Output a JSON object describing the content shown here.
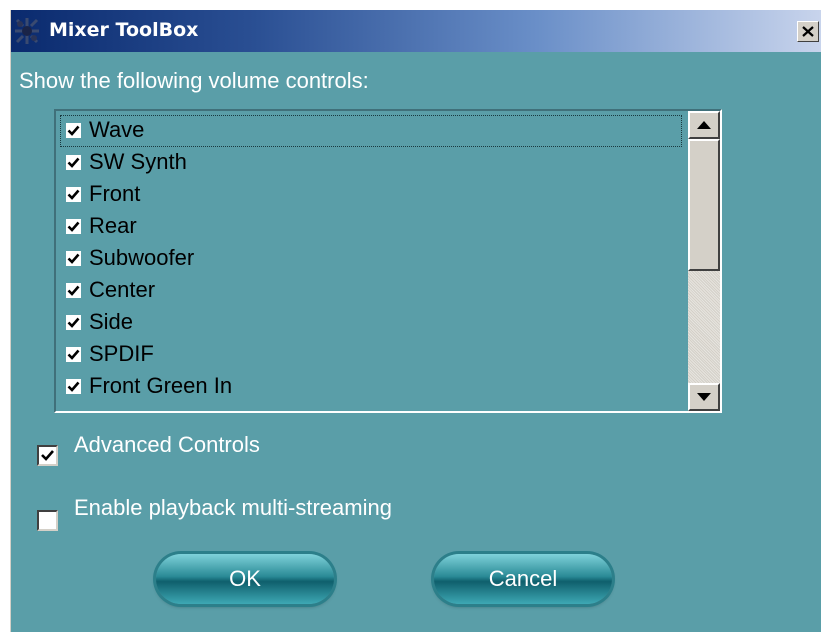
{
  "window": {
    "title": "Mixer ToolBox",
    "close_label": "×"
  },
  "prompt": "Show the following volume controls:",
  "list": {
    "items": [
      {
        "label": "Wave",
        "checked": true,
        "focused": true
      },
      {
        "label": "SW Synth",
        "checked": true
      },
      {
        "label": "Front",
        "checked": true
      },
      {
        "label": "Rear",
        "checked": true
      },
      {
        "label": "Subwoofer",
        "checked": true
      },
      {
        "label": "Center",
        "checked": true
      },
      {
        "label": "Side",
        "checked": true
      },
      {
        "label": "SPDIF",
        "checked": true
      },
      {
        "label": "Front Green In",
        "checked": true
      }
    ]
  },
  "options": {
    "advanced": {
      "label": "Advanced Controls",
      "checked": true
    },
    "multistream": {
      "label": "Enable playback multi-streaming",
      "checked": false
    }
  },
  "buttons": {
    "ok": "OK",
    "cancel": "Cancel"
  },
  "colors": {
    "dialog_bg": "#5a9ea8",
    "title_start": "#0a2a6e",
    "title_end": "#c8d4ec",
    "button_teal": "#2a8a96"
  },
  "icons": {
    "app": "mixer-app-icon",
    "close": "close-icon",
    "scroll_up": "scroll-up-arrow-icon",
    "scroll_down": "scroll-down-arrow-icon",
    "check": "checkmark-icon"
  }
}
